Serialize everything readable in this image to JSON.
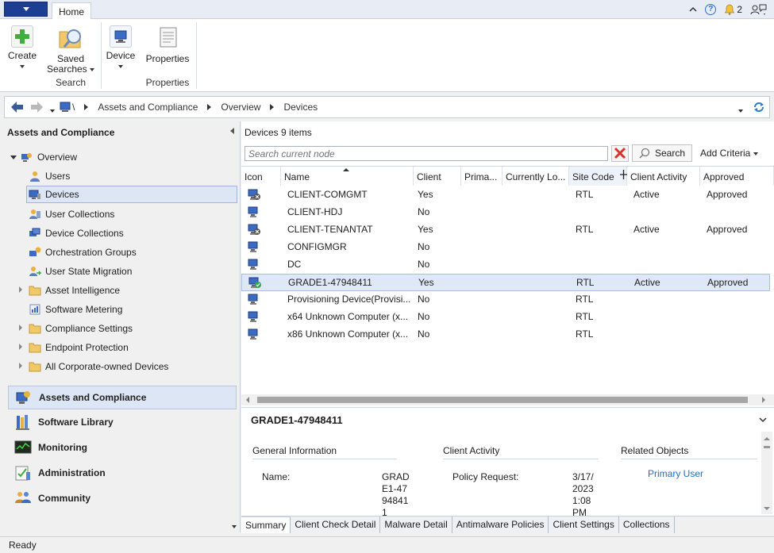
{
  "ribbon": {
    "tab_home": "Home",
    "notifications_count": "2",
    "create": "Create",
    "saved_searches_line1": "Saved",
    "saved_searches_line2": "Searches",
    "search_group": "Search",
    "device": "Device",
    "properties": "Properties",
    "properties_group": "Properties"
  },
  "address": {
    "root": "\\",
    "crumbs": [
      "Assets and Compliance",
      "Overview",
      "Devices"
    ]
  },
  "left": {
    "title": "Assets and Compliance",
    "tree": [
      {
        "label": "Overview",
        "icon": "overview-icon"
      },
      {
        "label": "Users",
        "icon": "users-icon"
      },
      {
        "label": "Devices",
        "icon": "devices-icon"
      },
      {
        "label": "User Collections",
        "icon": "user-collections-icon"
      },
      {
        "label": "Device Collections",
        "icon": "device-collections-icon"
      },
      {
        "label": "Orchestration Groups",
        "icon": "orchestration-groups-icon"
      },
      {
        "label": "User State Migration",
        "icon": "user-state-migration-icon"
      },
      {
        "label": "Asset Intelligence",
        "icon": "folder-icon"
      },
      {
        "label": "Software Metering",
        "icon": "software-metering-icon"
      },
      {
        "label": "Compliance Settings",
        "icon": "folder-icon"
      },
      {
        "label": "Endpoint Protection",
        "icon": "folder-icon"
      },
      {
        "label": "All Corporate-owned Devices",
        "icon": "folder-icon"
      }
    ],
    "workspaces": [
      {
        "label": "Assets and Compliance",
        "icon": "assets-compliance-icon"
      },
      {
        "label": "Software Library",
        "icon": "software-library-icon"
      },
      {
        "label": "Monitoring",
        "icon": "monitoring-icon"
      },
      {
        "label": "Administration",
        "icon": "administration-icon"
      },
      {
        "label": "Community",
        "icon": "community-icon"
      }
    ]
  },
  "list": {
    "title": "Devices 9 items",
    "search_placeholder": "Search current node",
    "search_button": "Search",
    "add_criteria": "Add Criteria",
    "columns": [
      "Icon",
      "Name",
      "Client",
      "Prima...",
      "Currently Lo...",
      "Site Code",
      "Client Activity",
      "Approved"
    ],
    "rows": [
      {
        "name": "CLIENT-COMGMT",
        "client": "Yes",
        "site": "RTL",
        "activity": "Active",
        "approved": "Approved",
        "icon": "client-device-icon"
      },
      {
        "name": "CLIENT-HDJ",
        "client": "No",
        "site": "",
        "activity": "",
        "approved": "",
        "icon": "device-icon"
      },
      {
        "name": "CLIENT-TENANTAT",
        "client": "Yes",
        "site": "RTL",
        "activity": "Active",
        "approved": "Approved",
        "icon": "client-device-icon"
      },
      {
        "name": "CONFIGMGR",
        "client": "No",
        "site": "",
        "activity": "",
        "approved": "",
        "icon": "device-icon"
      },
      {
        "name": "DC",
        "client": "No",
        "site": "",
        "activity": "",
        "approved": "",
        "icon": "device-icon"
      },
      {
        "name": "GRADE1-47948411",
        "client": "Yes",
        "site": "RTL",
        "activity": "Active",
        "approved": "Approved",
        "icon": "healthy-device-icon"
      },
      {
        "name": "Provisioning Device(Provisi...",
        "client": "No",
        "site": "RTL",
        "activity": "",
        "approved": "",
        "icon": "device-icon"
      },
      {
        "name": "x64 Unknown Computer (x...",
        "client": "No",
        "site": "RTL",
        "activity": "",
        "approved": "",
        "icon": "device-icon"
      },
      {
        "name": "x86 Unknown Computer (x...",
        "client": "No",
        "site": "RTL",
        "activity": "",
        "approved": "",
        "icon": "device-icon"
      }
    ]
  },
  "details": {
    "title": "GRADE1-47948411",
    "general_information": "General Information",
    "name_label": "Name:",
    "name_value_lines": [
      "GRAD",
      "E1-47",
      "94841",
      "1"
    ],
    "client_activity": "Client Activity",
    "policy_request_label": "Policy Request:",
    "policy_request_lines": [
      "3/17/",
      "2023",
      "1:08",
      "PM"
    ],
    "related_objects": "Related Objects",
    "primary_user_link": "Primary User",
    "tabs": [
      "Summary",
      "Client Check Detail",
      "Malware Detail",
      "Antimalware Policies",
      "Client Settings",
      "Collections"
    ]
  },
  "status": "Ready"
}
